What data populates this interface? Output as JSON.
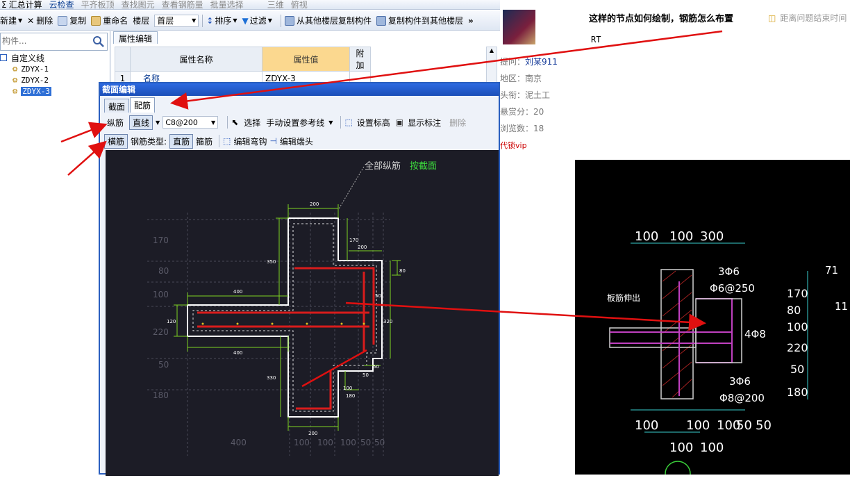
{
  "toolbar1": {
    "items": [
      "汇总计算",
      "云检查",
      "平齐板顶",
      "查找图元",
      "查看钢筋量",
      "批量选择",
      "三维",
      "俯视"
    ]
  },
  "toolbar2": {
    "new": "新建",
    "delete": "删除",
    "copy": "复制",
    "rename": "重命名",
    "floor_label": "楼层",
    "floor_value": "首层",
    "sort": "排序",
    "filter": "过滤",
    "copy_from": "从其他楼层复制构件",
    "copy_to": "复制构件到其他楼层"
  },
  "search": {
    "placeholder": "构件..."
  },
  "tree": {
    "root": "自定义线",
    "items": [
      "ZDYX-1",
      "ZDYX-2",
      "ZDYX-3"
    ]
  },
  "property_editor": {
    "tab": "属性编辑",
    "headers": [
      "属性名称",
      "属性值",
      "附加"
    ],
    "rows": [
      {
        "index": "1",
        "name": "名称",
        "value": "ZDYX-3"
      }
    ]
  },
  "dialog": {
    "title": "截面编辑",
    "tabs": [
      "截面",
      "配筋"
    ],
    "row1": {
      "longitudinal": "纵筋",
      "mode": "直线",
      "rebar_value": "C8@200",
      "select": "选择",
      "ref_line": "手动设置参考线",
      "set_elevation": "设置标高",
      "show_labels": "显示标注",
      "delete": "删除"
    },
    "row2": {
      "transverse": "横筋",
      "type_label": "钢筋类型:",
      "type_straight": "直筋",
      "type_stirrup": "箍筋",
      "edit_hook": "编辑弯钩",
      "edit_end": "编辑端头"
    },
    "canvas": {
      "note_all": "全部纵筋",
      "note_section": "按截面",
      "left_dims": [
        "170",
        "80",
        "100",
        "220",
        "50",
        "180"
      ],
      "bottom_dims": [
        "400",
        "100",
        "100",
        "100",
        "50",
        "50"
      ],
      "inner_dims": [
        "200",
        "350",
        "170",
        "200",
        "80",
        "400",
        "50",
        "120",
        "320",
        "400",
        "330",
        "50",
        "50",
        "100",
        "180",
        "200"
      ]
    }
  },
  "question": {
    "title": "这样的节点如何绘制，钢筋怎么布置",
    "time_label": "距离问题结束时间",
    "body": "RT",
    "meta": [
      {
        "label": "提问：",
        "value": "刘某911"
      },
      {
        "label": "地区：",
        "value": "南京"
      },
      {
        "label": "头衔：",
        "value": "泥土工"
      },
      {
        "label": "悬赏分：",
        "value": "20"
      },
      {
        "label": "浏览数：",
        "value": "18"
      }
    ],
    "vip": "代锁vip"
  },
  "cad": {
    "top_dims": [
      "100",
      "100",
      "300"
    ],
    "right_dims": [
      "170",
      "80",
      "100",
      "220",
      "50",
      "180"
    ],
    "bottom_dims": [
      "100",
      "100",
      "50",
      "50"
    ],
    "bottom_dims2": [
      "100",
      "100"
    ],
    "left_bottom": "100",
    "label_a1": "3Φ6",
    "label_a2": "Φ6@250",
    "label_b": "4Φ8",
    "label_c1": "3Φ6",
    "label_c2": "Φ8@200",
    "label_left": "板筋伸出",
    "edge_71": "71",
    "edge_11": "11"
  },
  "colors": {
    "accent_blue": "#2a5fbf",
    "annotation_red": "#e01010",
    "rebar_red": "#d81c1c",
    "dim_green": "#7ed321"
  }
}
